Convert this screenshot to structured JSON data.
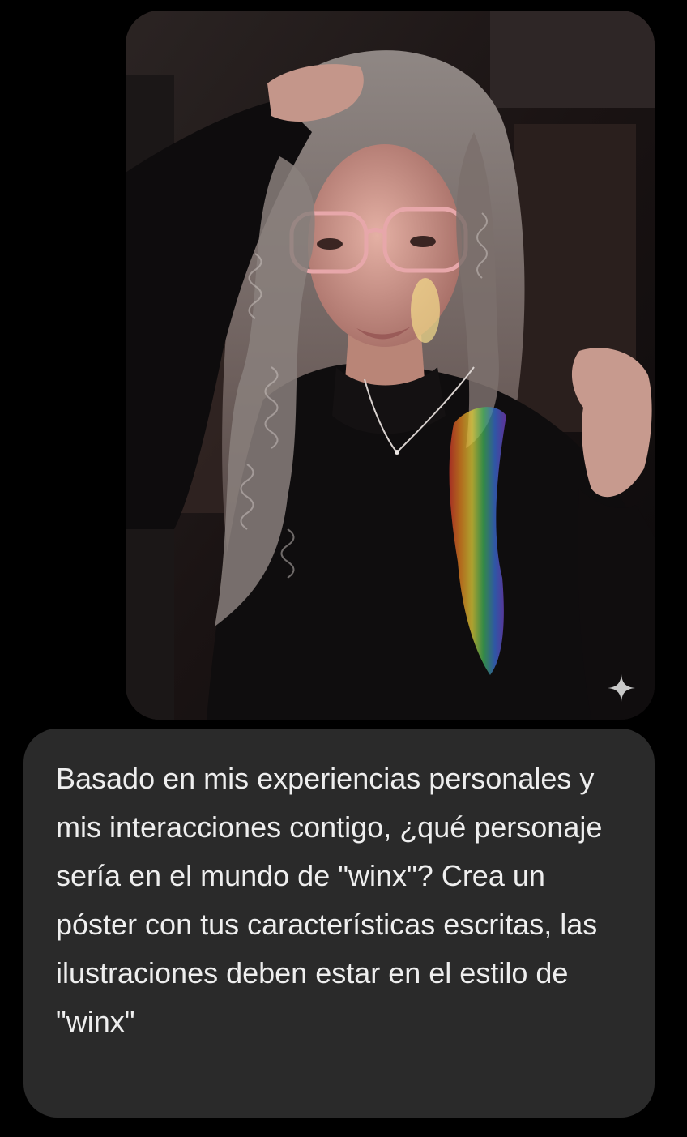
{
  "chat": {
    "photo_message": {
      "image_subject": "woman with long curly silver hair, pink glasses, black turtleneck, rainbow light on her chest",
      "badge_icon": "sparkle-icon"
    },
    "text_message": {
      "text": "Basado en mis experiencias personales y mis interacciones contigo, ¿qué personaje sería en el mundo de \"winx\"? Crea un póster con tus características escritas, las ilustraciones deben estar en el estilo de \"winx\""
    }
  },
  "colors": {
    "background": "#000000",
    "bubble": "#2a2a2a",
    "message_text": "#eeeeee",
    "sparkle": "#c8c8c8"
  }
}
